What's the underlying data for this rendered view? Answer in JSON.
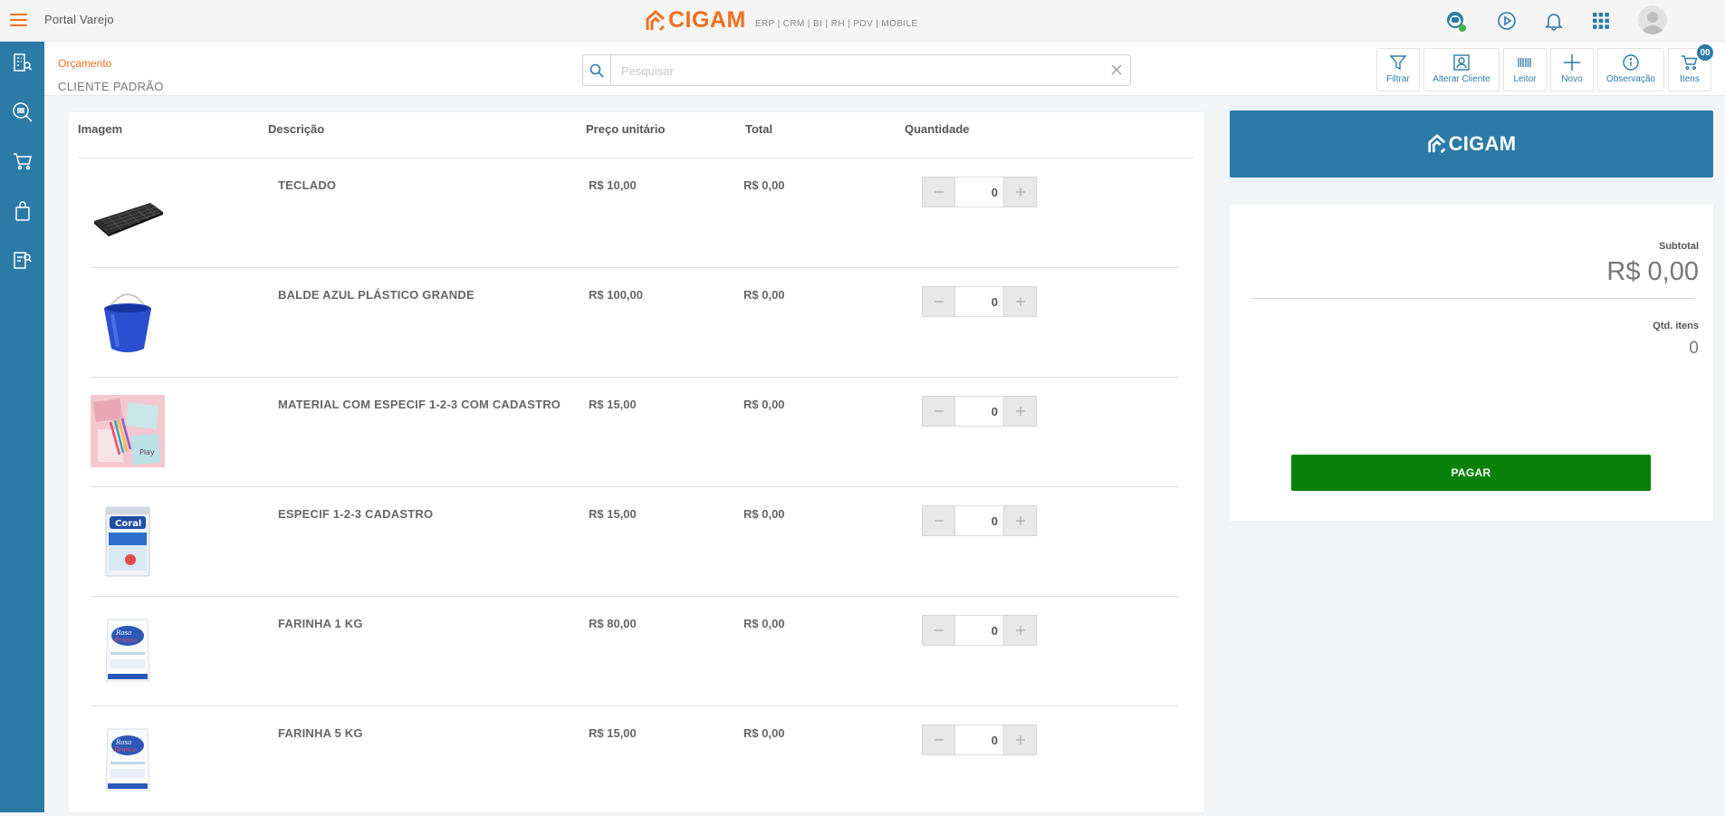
{
  "topbar": {
    "portal_title": "Portal Varejo",
    "brand_name": "CIGAM",
    "brand_tagline": "ERP | CRM | BI | RH | PDV | MOBILE",
    "icons": [
      "chat-support-icon",
      "play-circle-icon",
      "bell-icon",
      "apps-grid-icon",
      "user-avatar"
    ]
  },
  "sidebar": {
    "items": [
      "building-search-icon",
      "barcode-search-icon",
      "cart-icon",
      "shopping-bag-icon",
      "document-search-icon"
    ]
  },
  "subheader": {
    "breadcrumb": "Orçamento",
    "client": "CLIENTE PADRÃO",
    "search_placeholder": "Pesquisar",
    "actions": [
      {
        "label": "Filtrar",
        "icon": "filter-icon"
      },
      {
        "label": "Alterar Cliente",
        "icon": "person-card-icon"
      },
      {
        "label": "Leitor",
        "icon": "barcode-icon"
      },
      {
        "label": "Novo",
        "icon": "plus-icon"
      },
      {
        "label": "Observação",
        "icon": "info-icon"
      },
      {
        "label": "Itens",
        "icon": "cart-icon"
      }
    ],
    "cart_count": "00"
  },
  "table": {
    "headers": {
      "image": "Imagem",
      "description": "Descrição",
      "unit_price": "Preço unitário",
      "total": "Total",
      "quantity": "Quantidade"
    },
    "rows": [
      {
        "description": "TECLADO",
        "unit_price": "R$ 10,00",
        "total": "R$ 0,00",
        "quantity": "0",
        "image": "keyboard"
      },
      {
        "description": "BALDE AZUL PLÁSTICO GRANDE",
        "unit_price": "R$ 100,00",
        "total": "R$ 0,00",
        "quantity": "0",
        "image": "bucket"
      },
      {
        "description": "MATERIAL COM ESPECIF 1-2-3 COM CADASTRO",
        "unit_price": "R$ 15,00",
        "total": "R$ 0,00",
        "quantity": "0",
        "image": "stationery"
      },
      {
        "description": "ESPECIF 1-2-3 CADASTRO",
        "unit_price": "R$ 15,00",
        "total": "R$ 0,00",
        "quantity": "0",
        "image": "paint-can"
      },
      {
        "description": "FARINHA 1 KG",
        "unit_price": "R$ 80,00",
        "total": "R$ 0,00",
        "quantity": "0",
        "image": "flour-bag"
      },
      {
        "description": "FARINHA 5 KG",
        "unit_price": "R$ 15,00",
        "total": "R$ 0,00",
        "quantity": "0",
        "image": "flour-bag"
      }
    ]
  },
  "summary": {
    "logo_text": "CIGAM",
    "subtotal_label": "Subtotal",
    "subtotal_value": "R$ 0,00",
    "items_label": "Qtd. itens",
    "items_value": "0",
    "pay_label": "PAGAR"
  },
  "colors": {
    "accent": "#f07020",
    "sidebar": "#2c7ba6",
    "pay": "#078207"
  }
}
